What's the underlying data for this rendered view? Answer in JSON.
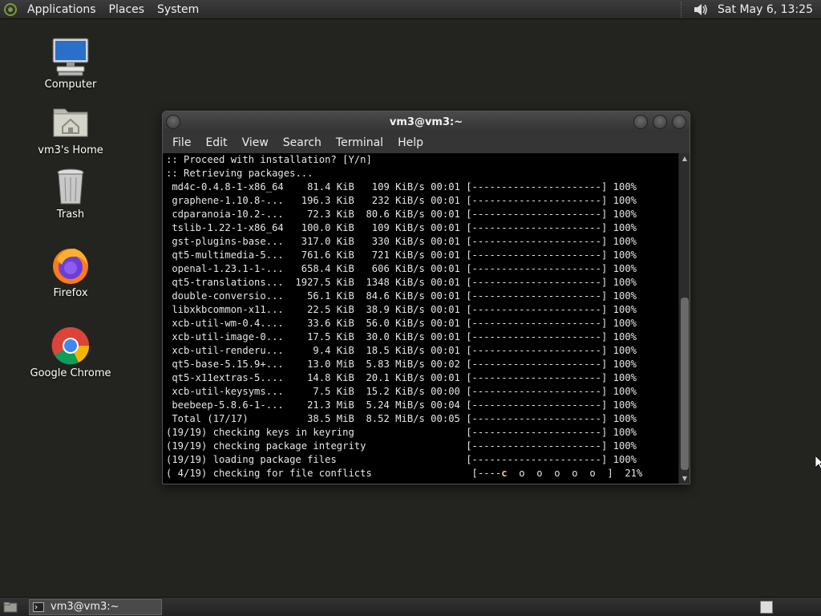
{
  "top_panel": {
    "menus": [
      "Applications",
      "Places",
      "System"
    ],
    "clock": "Sat May  6, 13:25"
  },
  "desktop": {
    "icons": [
      {
        "label": "Computer",
        "icon": "computer-icon"
      },
      {
        "label": "vm3's Home",
        "icon": "home-folder-icon"
      },
      {
        "label": "Trash",
        "icon": "trash-icon"
      },
      {
        "label": "Firefox",
        "icon": "firefox-icon"
      },
      {
        "label": "Google Chrome",
        "icon": "chrome-icon"
      }
    ]
  },
  "terminal": {
    "title": "vm3@vm3:~",
    "menu": [
      "File",
      "Edit",
      "View",
      "Search",
      "Terminal",
      "Help"
    ],
    "lines": [
      ":: Proceed with installation? [Y/n]",
      ":: Retrieving packages...",
      " md4c-0.4.8-1-x86_64    81.4 KiB   109 KiB/s 00:01 [----------------------] 100%",
      " graphene-1.10.8-...   196.3 KiB   232 KiB/s 00:01 [----------------------] 100%",
      " cdparanoia-10.2-...    72.3 KiB  80.6 KiB/s 00:01 [----------------------] 100%",
      " tslib-1.22-1-x86_64   100.0 KiB   109 KiB/s 00:01 [----------------------] 100%",
      " gst-plugins-base...   317.0 KiB   330 KiB/s 00:01 [----------------------] 100%",
      " qt5-multimedia-5...   761.6 KiB   721 KiB/s 00:01 [----------------------] 100%",
      " openal-1.23.1-1-...   658.4 KiB   606 KiB/s 00:01 [----------------------] 100%",
      " qt5-translations...  1927.5 KiB  1348 KiB/s 00:01 [----------------------] 100%",
      " double-conversio...    56.1 KiB  84.6 KiB/s 00:01 [----------------------] 100%",
      " libxkbcommon-x11...    22.5 KiB  38.9 KiB/s 00:01 [----------------------] 100%",
      " xcb-util-wm-0.4....    33.6 KiB  56.0 KiB/s 00:01 [----------------------] 100%",
      " xcb-util-image-0...    17.5 KiB  30.0 KiB/s 00:01 [----------------------] 100%",
      " xcb-util-renderu...     9.4 KiB  18.5 KiB/s 00:01 [----------------------] 100%",
      " qt5-base-5.15.9+...    13.0 MiB  5.83 MiB/s 00:02 [----------------------] 100%",
      " qt5-x11extras-5....    14.8 KiB  20.1 KiB/s 00:01 [----------------------] 100%",
      " xcb-util-keysyms...     7.5 KiB  15.2 KiB/s 00:00 [----------------------] 100%",
      " beebeep-5.8.6-1-...    21.3 MiB  5.24 MiB/s 00:04 [----------------------] 100%",
      " Total (17/17)          38.5 MiB  8.52 MiB/s 00:05 [----------------------] 100%",
      "(19/19) checking keys in keyring                   [----------------------] 100%",
      "(19/19) checking package integrity                 [----------------------] 100%",
      "(19/19) loading package files                      [----------------------] 100%"
    ],
    "last_line": {
      "prefix": "( 4/19) checking for file conflicts                 [----",
      "pac": "c",
      "suffix": "  o  o  o  o  o  ]  21%"
    }
  },
  "taskbar": {
    "task_label": "vm3@vm3:~"
  }
}
